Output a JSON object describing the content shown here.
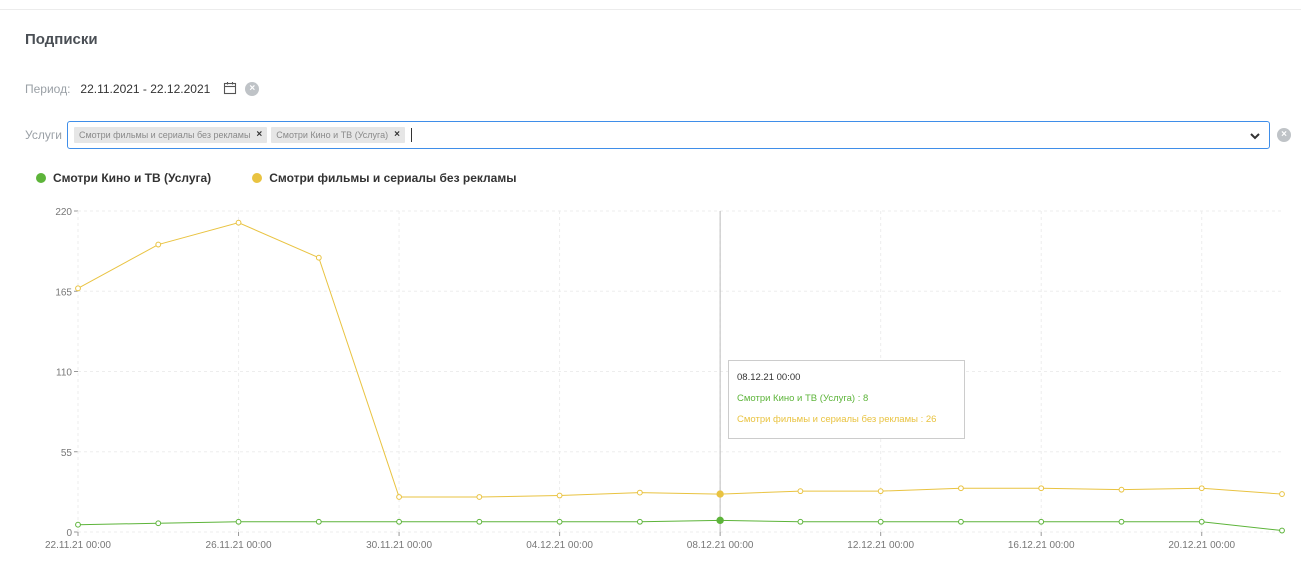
{
  "page": {
    "title": "Подписки"
  },
  "period": {
    "label": "Период:",
    "value": "22.11.2021 - 22.12.2021",
    "clear_symbol": "×",
    "icon": "calendar-icon"
  },
  "services": {
    "label": "Услуги",
    "tags": [
      {
        "label": "Смотри фильмы и сериалы без рекламы",
        "remove": "×"
      },
      {
        "label": "Смотри Кино и ТВ (Услуга)",
        "remove": "×"
      }
    ],
    "clear_symbol": "×",
    "icon": "chevron-down-icon"
  },
  "colors": {
    "green": "#5db43a",
    "yellow": "#e9c341",
    "accent": "#3f8ee9"
  },
  "chart_data": {
    "type": "line",
    "x": [
      "22.11.21 00:00",
      "24.11.21 00:00",
      "26.11.21 00:00",
      "28.11.21 00:00",
      "30.11.21 00:00",
      "02.12.21 00:00",
      "04.12.21 00:00",
      "06.12.21 00:00",
      "08.12.21 00:00",
      "10.12.21 00:00",
      "12.12.21 00:00",
      "14.12.21 00:00",
      "16.12.21 00:00",
      "18.12.21 00:00",
      "20.12.21 00:00",
      "22.12.21 00:00"
    ],
    "x_tick_labels": [
      "22.11.21 00:00",
      "26.11.21 00:00",
      "30.11.21 00:00",
      "04.12.21 00:00",
      "08.12.21 00:00",
      "12.12.21 00:00",
      "16.12.21 00:00",
      "20.12.21 00:00"
    ],
    "series": [
      {
        "name": "Смотри Кино и ТВ (Услуга)",
        "color": "#5db43a",
        "values": [
          5,
          6,
          7,
          7,
          7,
          7,
          7,
          7,
          8,
          7,
          7,
          7,
          7,
          7,
          7,
          1
        ]
      },
      {
        "name": "Смотри фильмы и сериалы без рекламы",
        "color": "#e9c341",
        "values": [
          167,
          197,
          212,
          188,
          24,
          24,
          25,
          27,
          26,
          28,
          28,
          30,
          30,
          29,
          30,
          26
        ]
      }
    ],
    "y_ticks": [
      0,
      55,
      110,
      165,
      220
    ],
    "ylim": [
      0,
      220
    ],
    "grid": true,
    "legend_position": "top-left",
    "highlight_index": 8,
    "tooltip": {
      "title": "08.12.21 00:00",
      "lines": [
        {
          "text": "Смотри Кино и ТВ (Услуга) : 8",
          "color": "#5db43a"
        },
        {
          "text": "Смотри фильмы и сериалы без рекламы : 26",
          "color": "#e9c341"
        }
      ]
    }
  }
}
